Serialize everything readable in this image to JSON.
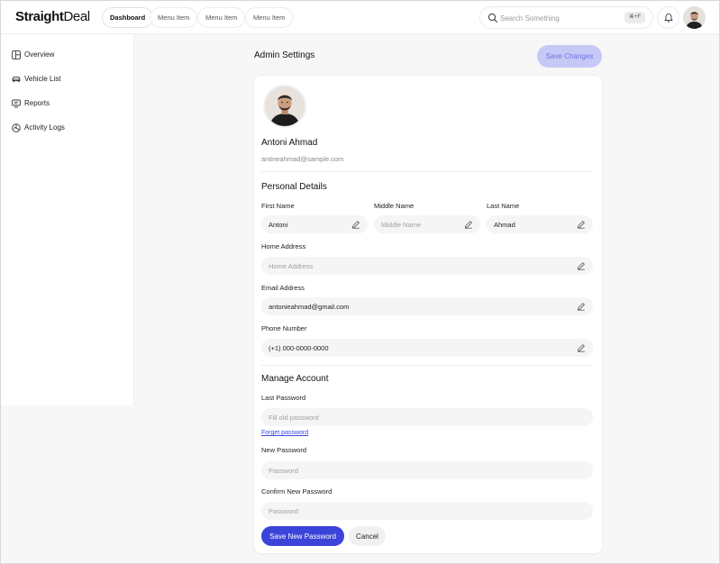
{
  "header": {
    "logo_bold": "Straight",
    "logo_rest": "Deal",
    "tabs": [
      {
        "label": "Dashboard",
        "active": true
      },
      {
        "label": "Menu Item",
        "active": false
      },
      {
        "label": "Menu Item",
        "active": false
      },
      {
        "label": "Menu Item",
        "active": false
      }
    ],
    "search_placeholder": "Search Something",
    "search_shortcut": "⌘+F",
    "icons": [
      "search-icon",
      "bell-icon",
      "user-avatar"
    ]
  },
  "sidebar": {
    "items": [
      {
        "label": "Overview",
        "icon": "layout-icon"
      },
      {
        "label": "Vehicle List",
        "icon": "car-icon"
      },
      {
        "label": "Reports",
        "icon": "monitor-icon"
      },
      {
        "label": "Activity Logs",
        "icon": "chart-icon"
      }
    ]
  },
  "main": {
    "title": "Admin Settings",
    "save_changes": "Save Changes",
    "profile": {
      "name": "Antoni Ahmad",
      "email": "antineahmad@sample.com"
    },
    "personal": {
      "title": "Personal Details",
      "first_name": {
        "label": "First Name",
        "value": "Antoni",
        "placeholder": ""
      },
      "middle_name": {
        "label": "Middle Name",
        "value": "",
        "placeholder": "Middle Name"
      },
      "last_name": {
        "label": "Last Name",
        "value": "Ahmad",
        "placeholder": ""
      },
      "home_address": {
        "label": "Home Address",
        "value": "",
        "placeholder": "Home Address"
      },
      "email_address": {
        "label": "Email Address",
        "value": "antonieahmad@gmail.com",
        "placeholder": ""
      },
      "phone": {
        "label": "Phone Number",
        "value": "(+1) 000-0000-0000",
        "placeholder": ""
      }
    },
    "account": {
      "title": "Manage Account",
      "last_password": {
        "label": "Last Password",
        "placeholder": "Fill old password"
      },
      "forget": "Forget password",
      "new_password": {
        "label": "New Password",
        "placeholder": "Password"
      },
      "confirm_password": {
        "label": "Confirm New Password",
        "placeholder": "Password"
      },
      "save_button": "Save New Password",
      "cancel_button": "Cancel"
    }
  },
  "colors": {
    "primary": "#3b44d9",
    "primary_soft": "#c6c9f5",
    "link": "#3b4bd8"
  }
}
